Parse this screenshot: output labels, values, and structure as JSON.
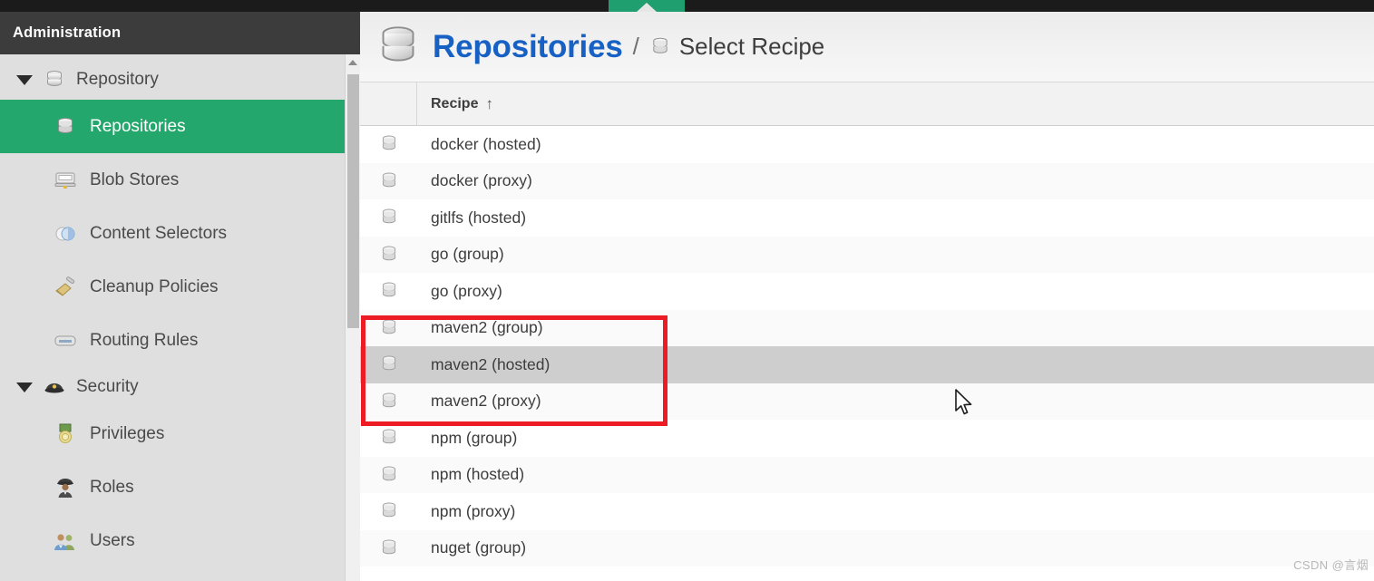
{
  "window": {
    "top_strip_color": "#1b1b1b",
    "active_tab_color": "#1f9e6f"
  },
  "sidebar": {
    "title": "Administration",
    "accent_color": "#24a76c",
    "groups": [
      {
        "label": "Repository",
        "icon": "database-icon",
        "expanded": true,
        "items": [
          {
            "label": "Repositories",
            "icon": "database-icon",
            "active": true
          },
          {
            "label": "Blob Stores",
            "icon": "blob-store-icon",
            "active": false
          },
          {
            "label": "Content Selectors",
            "icon": "content-selector-icon",
            "active": false
          },
          {
            "label": "Cleanup Policies",
            "icon": "broom-icon",
            "active": false
          },
          {
            "label": "Routing Rules",
            "icon": "routing-rules-icon",
            "active": false
          }
        ]
      },
      {
        "label": "Security",
        "icon": "police-hat-icon",
        "expanded": true,
        "items": [
          {
            "label": "Privileges",
            "icon": "medal-icon",
            "active": false
          },
          {
            "label": "Roles",
            "icon": "officer-icon",
            "active": false
          },
          {
            "label": "Users",
            "icon": "users-icon",
            "active": false
          }
        ]
      }
    ],
    "scrollbar": {
      "up_arrow": "scroll-up-icon"
    }
  },
  "breadcrumb": {
    "root_label": "Repositories",
    "root_icon": "database-icon",
    "separator": "/",
    "leaf_icon": "database-icon",
    "leaf_label": "Select Recipe",
    "root_color": "#1861c4"
  },
  "table": {
    "columns": [
      {
        "key": "icon",
        "label": ""
      },
      {
        "key": "recipe",
        "label": "Recipe",
        "sort": "asc",
        "sort_glyph": "↑"
      }
    ],
    "rows": [
      {
        "icon": "database-icon",
        "recipe": "docker (hosted)",
        "hovered": false
      },
      {
        "icon": "database-icon",
        "recipe": "docker (proxy)",
        "hovered": false
      },
      {
        "icon": "database-icon",
        "recipe": "gitlfs (hosted)",
        "hovered": false
      },
      {
        "icon": "database-icon",
        "recipe": "go (group)",
        "hovered": false
      },
      {
        "icon": "database-icon",
        "recipe": "go (proxy)",
        "hovered": false
      },
      {
        "icon": "database-icon",
        "recipe": "maven2 (group)",
        "hovered": false
      },
      {
        "icon": "database-icon",
        "recipe": "maven2 (hosted)",
        "hovered": true
      },
      {
        "icon": "database-icon",
        "recipe": "maven2 (proxy)",
        "hovered": false
      },
      {
        "icon": "database-icon",
        "recipe": "npm (group)",
        "hovered": false
      },
      {
        "icon": "database-icon",
        "recipe": "npm (hosted)",
        "hovered": false
      },
      {
        "icon": "database-icon",
        "recipe": "npm (proxy)",
        "hovered": false
      },
      {
        "icon": "database-icon",
        "recipe": "nuget (group)",
        "hovered": false
      }
    ]
  },
  "annotation": {
    "highlight_color": "#ed1c24",
    "covers_rows": [
      "maven2 (group)",
      "maven2 (hosted)",
      "maven2 (proxy)"
    ]
  },
  "cursor": {
    "icon": "mouse-pointer-icon"
  },
  "watermark": {
    "text": "CSDN @言烟"
  }
}
